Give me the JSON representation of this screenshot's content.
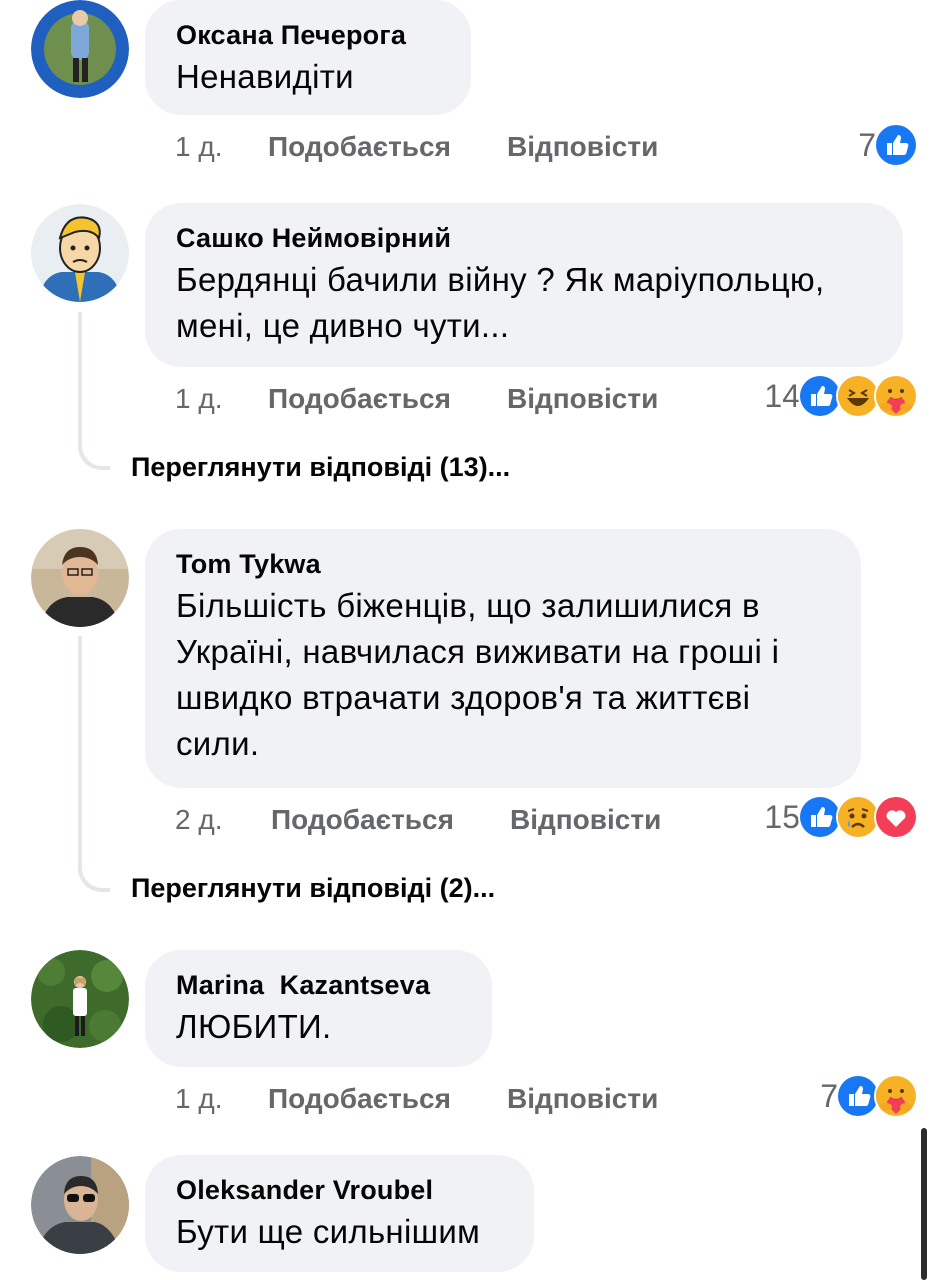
{
  "comments": [
    {
      "author": "Оксана Печерога",
      "text": "Ненавидіти",
      "time": "1 д.",
      "like_label": "Подобається",
      "reply_label": "Відповісти",
      "reaction_count": "7",
      "reactions": [
        "like-icon"
      ]
    },
    {
      "author": "Сашко Неймовірний",
      "text": "Бердянці бачили війну ? Як маріупольцю, мені, це дивно чути...",
      "time": "1 д.",
      "like_label": "Подобається",
      "reply_label": "Відповісти",
      "reaction_count": "14",
      "reactions": [
        "like-icon",
        "haha-icon",
        "care-icon"
      ],
      "view_replies": "Переглянути відповіді (13)..."
    },
    {
      "author": "Tom Tykwa",
      "text": "Більшість біженців, що залишилися в Україні, навчилася виживати на гроші і швидко втрачати здоров'я та життєві сили.",
      "time": "2 д.",
      "like_label": "Подобається",
      "reply_label": "Відповісти",
      "reaction_count": "15",
      "reactions": [
        "like-icon",
        "sad-icon",
        "love-icon"
      ],
      "view_replies": "Переглянути відповіді (2)..."
    },
    {
      "author": "Marina  Kazantseva",
      "text": "ЛЮБИТИ.",
      "time": "1 д.",
      "like_label": "Подобається",
      "reply_label": "Відповісти",
      "reaction_count": "7",
      "reactions": [
        "like-icon",
        "care-icon"
      ]
    },
    {
      "author": "Oleksander Vroubel",
      "text": "Бути ще сильнішим"
    }
  ],
  "colors": {
    "bubble_bg": "#f0f2f5",
    "meta_text": "#65676b",
    "like_blue": "#1877f2",
    "love_red": "#f33e58",
    "emoji_yellow": "#f7b125"
  }
}
